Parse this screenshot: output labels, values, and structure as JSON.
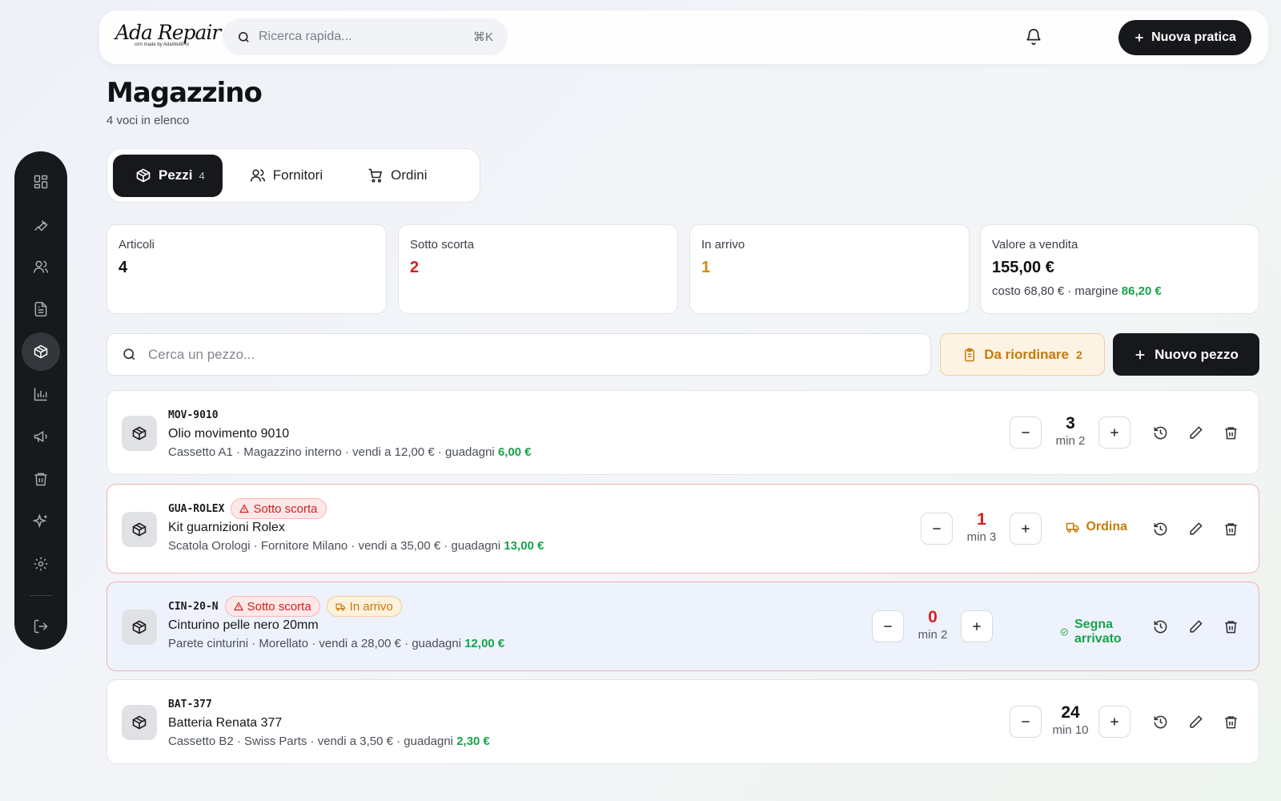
{
  "app": {
    "logo": "Ada Repair",
    "logo_tagline": "crm made by AdaWebPro"
  },
  "topbar": {
    "search_placeholder": "Ricerca rapida...",
    "search_shortcut": "⌘K",
    "new_case_label": "Nuova pratica"
  },
  "sidebar": {
    "items": [
      {
        "name": "dashboard-icon"
      },
      {
        "name": "wrench-icon"
      },
      {
        "name": "users-icon"
      },
      {
        "name": "document-icon"
      },
      {
        "name": "package-icon",
        "active": true
      },
      {
        "name": "bar-chart-icon"
      },
      {
        "name": "megaphone-icon"
      },
      {
        "name": "trash-icon"
      },
      {
        "name": "sparkles-icon"
      },
      {
        "name": "gear-icon"
      }
    ],
    "logout_icon": "logout-icon"
  },
  "page": {
    "title": "Magazzino",
    "subtitle": "4 voci in elenco"
  },
  "tabs": [
    {
      "label": "Pezzi",
      "count": "4",
      "active": true,
      "icon": "package-icon"
    },
    {
      "label": "Fornitori",
      "count": "",
      "active": false,
      "icon": "users-icon"
    },
    {
      "label": "Ordini",
      "count": "",
      "active": false,
      "icon": "cart-icon"
    }
  ],
  "stats": {
    "articoli": {
      "label": "Articoli",
      "value": "4"
    },
    "sotto_scorta": {
      "label": "Sotto scorta",
      "value": "2"
    },
    "in_arrivo": {
      "label": "In arrivo",
      "value": "1"
    },
    "valore": {
      "label": "Valore a vendita",
      "value": "155,00 €",
      "sub_prefix": "costo 68,80 € · margine",
      "margin": "86,20 €"
    }
  },
  "toolbar": {
    "search_placeholder": "Cerca un pezzo...",
    "reorder_label": "Da riordinare",
    "reorder_count": "2",
    "new_piece_label": "Nuovo pezzo"
  },
  "labels": {
    "low_stock": "Sotto scorta",
    "incoming": "In arrivo",
    "order": "Ordina",
    "mark_arrived": "Segna arrivato"
  },
  "items": [
    {
      "sku": "MOV-9010",
      "name": "Olio movimento 9010",
      "meta": "Cassetto A1 · Magazzino interno · vendi a 12,00 € · guadagni",
      "profit": "6,00 €",
      "qty": "3",
      "min": "min 2"
    },
    {
      "sku": "GUA-ROLEX",
      "name": "Kit guarnizioni Rolex",
      "meta": "Scatola Orologi · Fornitore Milano · vendi a 35,00 € · guadagni",
      "profit": "13,00 €",
      "qty": "1",
      "min": "min 3"
    },
    {
      "sku": "CIN-20-N",
      "name": "Cinturino pelle nero 20mm",
      "meta": "Parete cinturini · Morellato · vendi a 28,00 € · guadagni",
      "profit": "12,00 €",
      "qty": "0",
      "min": "min 2"
    },
    {
      "sku": "BAT-377",
      "name": "Batteria Renata 377",
      "meta": "Cassetto B2 · Swiss Parts · vendi a 3,50 € · guadagni",
      "profit": "2,30 €",
      "qty": "24",
      "min": "min 10"
    }
  ],
  "colors": {
    "accent_dark": "#16181b",
    "green": "#17a34a",
    "red": "#d32020",
    "orange": "#d98a0a"
  }
}
